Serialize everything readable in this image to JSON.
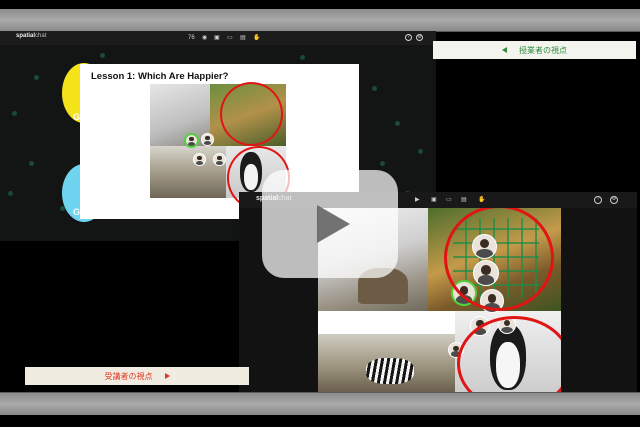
{
  "teacher_window": {
    "brand": "spatial",
    "brand_suffix": "chat",
    "toolbar_zoom": "76",
    "slide_title": "Lesson 1: Which Are Happier?",
    "bubble_label_1": "G",
    "bubble_label_2": "G"
  },
  "student_window": {
    "brand": "spatial",
    "brand_suffix": "chat",
    "help_icon_glyph": "?"
  },
  "labels": {
    "teacher_view": "授業者の視点",
    "student_view": "受講者の視点"
  },
  "colors": {
    "teacher_label": "#2e8b3c",
    "student_label": "#e03a25",
    "highlight_ring": "#e11414",
    "bubble_yellow": "#f5e31a",
    "bubble_cyan": "#6ed4f0",
    "active_avatar_ring": "#4fd13a"
  },
  "icons": [
    "play-icon",
    "settings-icon",
    "help-icon",
    "camera-icon",
    "screen-share-icon",
    "microphone-icon",
    "triangle-left-icon",
    "triangle-right-icon"
  ]
}
